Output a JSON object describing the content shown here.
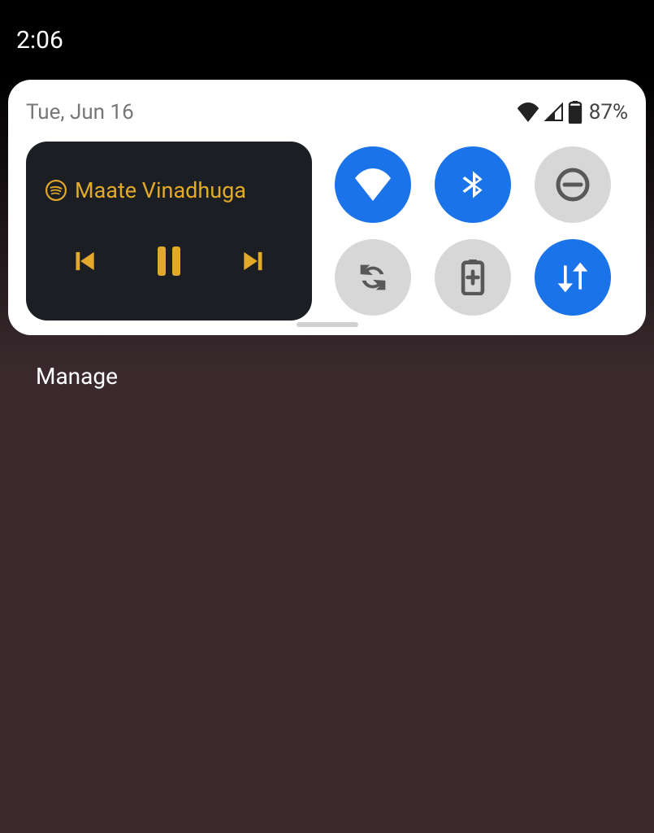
{
  "status": {
    "clock": "2:06",
    "battery_percent": "87%"
  },
  "panel": {
    "date": "Tue, Jun 16"
  },
  "media": {
    "app": "spotify",
    "title": "Maate Vinadhuga"
  },
  "quick_settings": {
    "wifi": {
      "on": true,
      "icon": "wifi"
    },
    "bluetooth": {
      "on": true,
      "icon": "bluetooth"
    },
    "dnd": {
      "on": false,
      "icon": "do-not-disturb"
    },
    "auto_rotate": {
      "on": false,
      "icon": "auto-rotate"
    },
    "battery_saver": {
      "on": false,
      "icon": "battery-saver"
    },
    "mobile_data": {
      "on": true,
      "icon": "mobile-data"
    }
  },
  "footer": {
    "manage_label": "Manage"
  }
}
